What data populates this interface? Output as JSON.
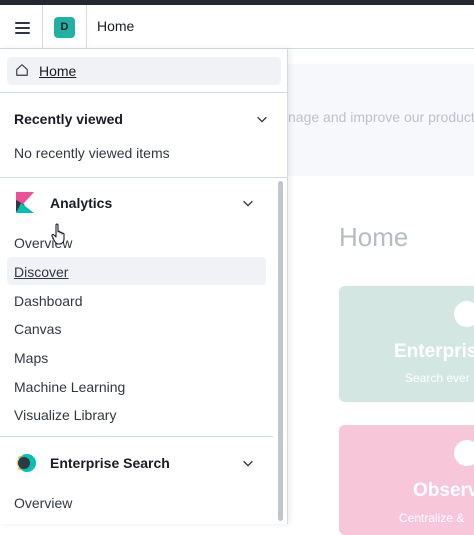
{
  "header": {
    "space_initial": "D",
    "breadcrumb": "Home"
  },
  "background": {
    "tagline": "nage and improve our products",
    "title": "Home",
    "cards": [
      {
        "title": "Enterprise",
        "subtitle": "Search ever",
        "color": "#d3e6e2"
      },
      {
        "title": "Observ",
        "subtitle": "Centralize &",
        "color": "#f7c6d8"
      }
    ]
  },
  "nav": {
    "home_label": "Home",
    "recently_viewed": {
      "title": "Recently viewed",
      "empty_text": "No recently viewed items"
    },
    "analytics": {
      "title": "Analytics",
      "items": [
        "Overview",
        "Discover",
        "Dashboard",
        "Canvas",
        "Maps",
        "Machine Learning",
        "Visualize Library"
      ]
    },
    "enterprise_search": {
      "title": "Enterprise Search",
      "items": [
        "Overview"
      ]
    }
  },
  "colors": {
    "accent": "#20b1a4",
    "kibana_pink": "#f04e98",
    "kibana_teal": "#00bfb3",
    "hover": "#f1f2f5"
  }
}
